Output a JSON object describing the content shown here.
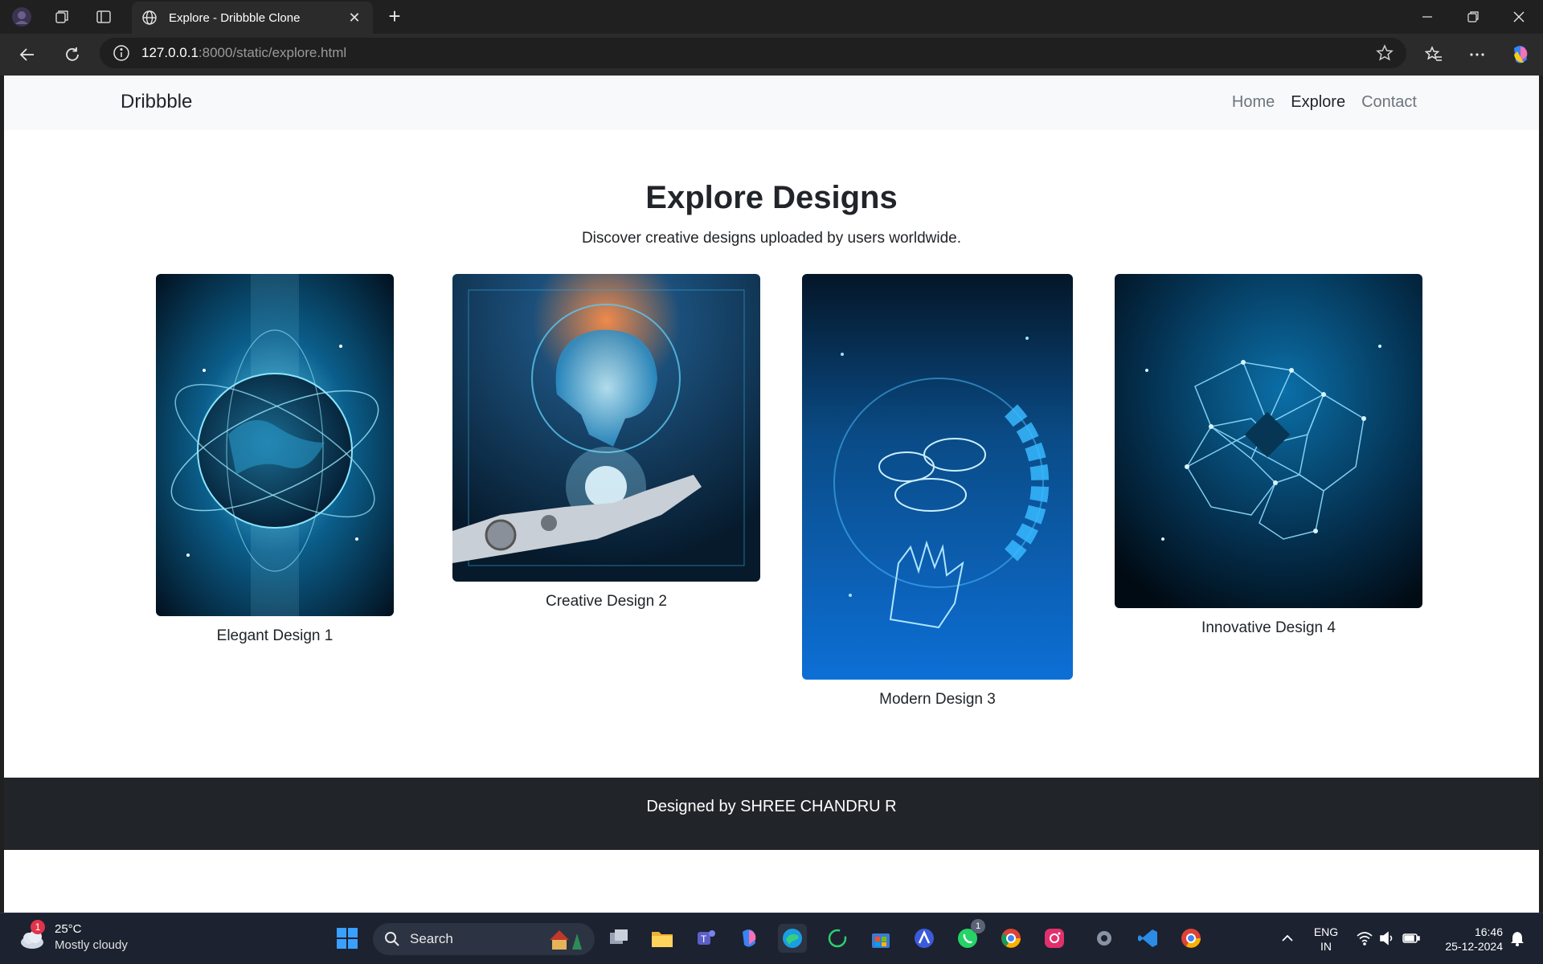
{
  "browser": {
    "tab_title": "Explore - Dribbble Clone",
    "tab_close": "✕",
    "new_tab": "+",
    "url_host": "127.0.0.1",
    "url_rest": ":8000/static/explore.html"
  },
  "navbar": {
    "brand": "Dribbble",
    "links": [
      "Home",
      "Explore",
      "Contact"
    ],
    "active_link": "Explore"
  },
  "main": {
    "title": "Explore Designs",
    "subtitle": "Discover creative designs uploaded by users worldwide.",
    "cards": [
      {
        "caption": "Elegant Design 1",
        "image_icon": "glowing-earth-orbit-image"
      },
      {
        "caption": "Creative Design 2",
        "image_icon": "robot-hand-brain-image"
      },
      {
        "caption": "Modern Design 3",
        "image_icon": "cloud-circuit-hand-image"
      },
      {
        "caption": "Innovative Design 4",
        "image_icon": "network-hands-image"
      }
    ]
  },
  "footer": {
    "text": "Designed by SHREE CHANDRU R"
  },
  "taskbar": {
    "weather_temp": "25°C",
    "weather_cond": "Mostly cloudy",
    "weather_badge": "1",
    "search_label": "Search",
    "whatsapp_badge": "1",
    "lang_top": "ENG",
    "lang_bottom": "IN",
    "time": "16:46",
    "date": "25-12-2024"
  },
  "colors": {
    "accent_blue": "#0d6efd",
    "footer_bg": "#212529",
    "navbar_bg": "#f8f9fa"
  }
}
